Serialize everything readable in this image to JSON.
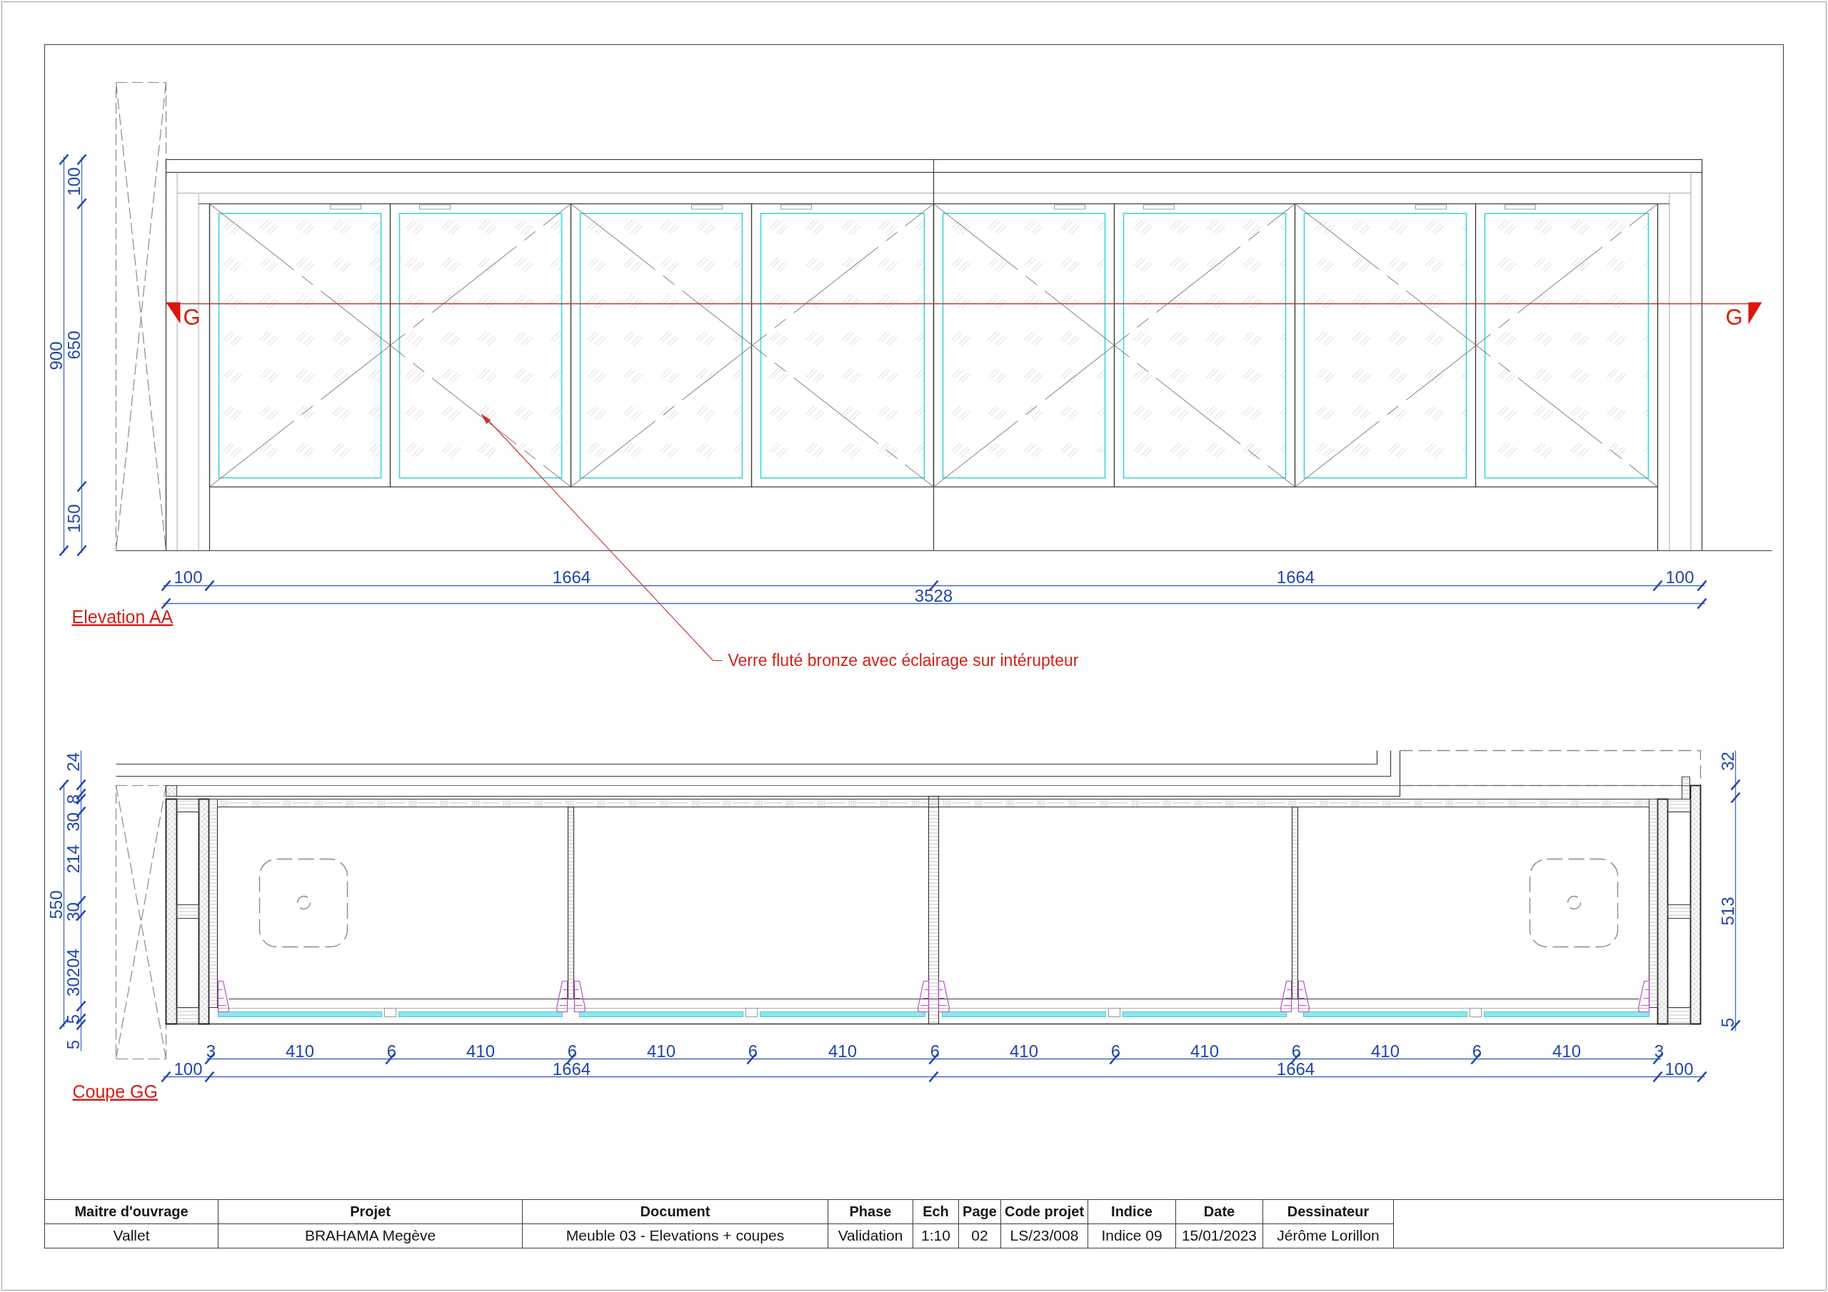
{
  "elevation_aa": {
    "title": "Elevation AA",
    "section_marks": [
      "G",
      "G"
    ],
    "note": "Verre fluté bronze avec éclairage sur intérupteur",
    "height_dimensions": {
      "overall": "900",
      "parts": [
        "100",
        "650",
        "150"
      ]
    },
    "width_dimensions": {
      "parts": [
        "100",
        "1664",
        "1664",
        "100"
      ],
      "overall": "3528"
    }
  },
  "section_gg": {
    "title": "Coupe GG",
    "height_dimensions_left": {
      "overall": "550",
      "parts": [
        "24",
        "8",
        "30",
        "214",
        "30",
        "30204",
        "5",
        "5"
      ]
    },
    "height_dimensions_right": {
      "parts": [
        "32",
        "513",
        "5"
      ]
    },
    "width_dimensions": {
      "panels": [
        "3",
        "410",
        "6",
        "410",
        "6",
        "410",
        "6",
        "410",
        "6",
        "410",
        "6",
        "410",
        "6",
        "410",
        "6",
        "410",
        "3"
      ],
      "parts": [
        "100",
        "1664",
        "1664",
        "100"
      ]
    }
  },
  "title_block": {
    "columns": [
      {
        "label": "Maitre d'ouvrage",
        "value": "Vallet"
      },
      {
        "label": "Projet",
        "value": "BRAHAMA Megève"
      },
      {
        "label": "Document",
        "value": "Meuble 03 - Elevations + coupes"
      },
      {
        "label": "Phase",
        "value": "Validation"
      },
      {
        "label": "Ech",
        "value": "1:10"
      },
      {
        "label": "Page",
        "value": "02"
      },
      {
        "label": "Code projet",
        "value": "LS/23/008"
      },
      {
        "label": "Indice",
        "value": "Indice 09"
      },
      {
        "label": "Date",
        "value": "15/01/2023"
      },
      {
        "label": "Dessinateur",
        "value": "Jérôme Lorillon"
      }
    ]
  }
}
